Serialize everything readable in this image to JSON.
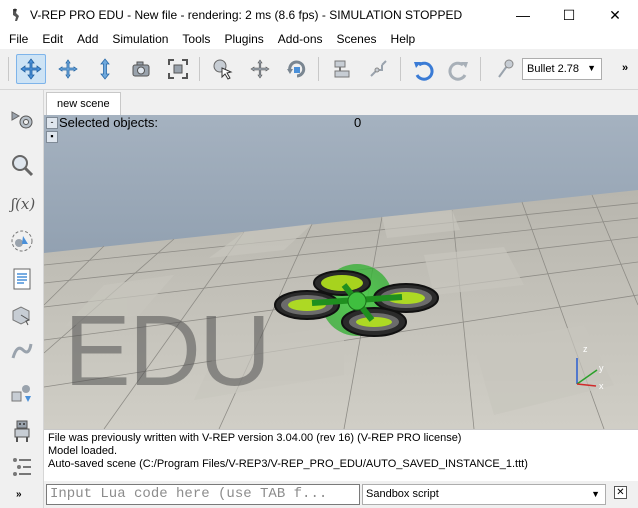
{
  "window": {
    "title": "V-REP PRO EDU - New file - rendering: 2 ms (8.6 fps) - SIMULATION STOPPED",
    "controls": {
      "minimize": "—",
      "maximize": "☐",
      "close": "✕"
    }
  },
  "menu": [
    "File",
    "Edit",
    "Add",
    "Simulation",
    "Tools",
    "Plugins",
    "Add-ons",
    "Scenes",
    "Help"
  ],
  "toolbar": {
    "buttons": [
      "camera-pan-icon",
      "camera-rotate-icon",
      "camera-shift-icon",
      "camera-angle-icon",
      "fit-to-view-icon",
      "object-select-icon",
      "object-translate-icon",
      "object-rotate-icon",
      "assemble-icon",
      "transfer-dna-icon",
      "undo-icon",
      "redo-icon",
      "dynamics-toggle-icon"
    ],
    "physics_engine": "Bullet 2.78",
    "more": "»"
  },
  "left_toolbar": {
    "buttons": [
      "scene-object-properties-icon",
      "calculation-modules-icon",
      "function-icon",
      "collections-icon",
      "scripts-icon",
      "shape-edit-icon",
      "path-edit-icon",
      "model-browser-icon",
      "scene-hierarchy-icon",
      "layers-icon"
    ],
    "more": "»"
  },
  "tab": {
    "label": "new scene"
  },
  "viewport": {
    "selected_label": "Selected objects:",
    "selected_count": "0",
    "watermark": "EDU",
    "axes": {
      "x": "x",
      "y": "y",
      "z": "z"
    }
  },
  "status": {
    "lines": [
      "File was previously written with V-REP version 3.04.00 (rev 16) (V-REP PRO license)",
      "Model loaded.",
      "Auto-saved scene (C:/Program Files/V-REP3/V-REP_PRO_EDU/AUTO_SAVED_INSTANCE_1.ttt)"
    ]
  },
  "lua": {
    "placeholder": "Input Lua code here (use TAB f...",
    "script_selector": "Sandbox script",
    "close": "✕"
  },
  "colors": {
    "accent_green": "#3fbf3f",
    "drone_lime": "#b5e61d",
    "active_tool_bg": "#cde3f5"
  }
}
